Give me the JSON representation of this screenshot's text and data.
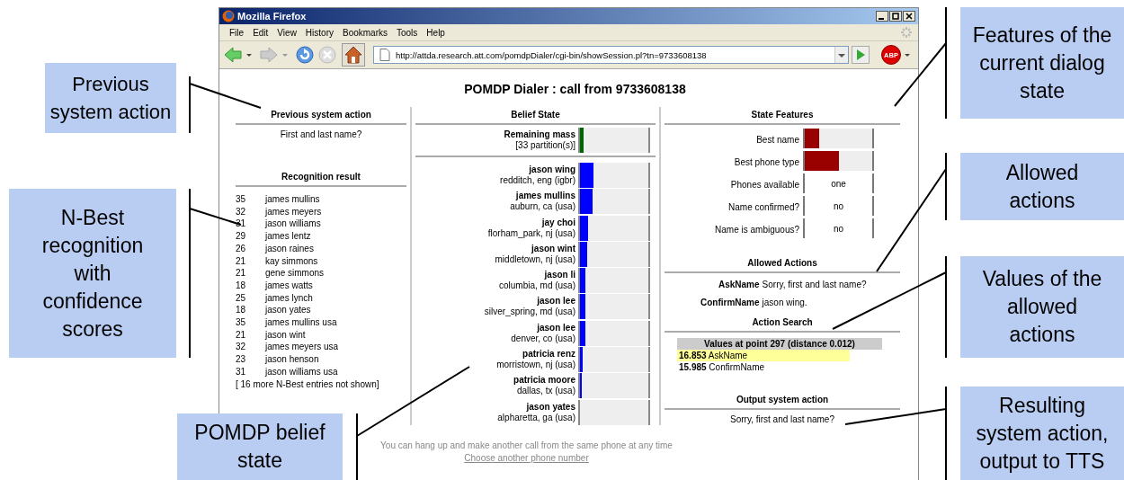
{
  "callouts": [
    {
      "text": "Previous system action"
    },
    {
      "text": "N-Best recognition with confidence scores"
    },
    {
      "text": "POMDP belief state"
    },
    {
      "text": "Features of the current dialog state"
    },
    {
      "text": "Allowed actions"
    },
    {
      "text": "Values of the allowed actions"
    },
    {
      "text": "Resulting system action, output to TTS"
    }
  ],
  "window": {
    "title": "Mozilla Firefox",
    "menu": [
      "File",
      "Edit",
      "View",
      "History",
      "Bookmarks",
      "Tools",
      "Help"
    ],
    "url": "http://attda.research.att.com/pomdpDialer/cgi-bin/showSession.pl?tn=9733608138",
    "adblock_label": "ABP"
  },
  "page": {
    "title": "POMDP Dialer : call from 9733608138",
    "previous_action": {
      "heading": "Previous system action",
      "text": "First and last name?"
    },
    "recognition": {
      "heading": "Recognition result",
      "rows": [
        {
          "score": "35",
          "name": "james mullins"
        },
        {
          "score": "32",
          "name": "james meyers"
        },
        {
          "score": "31",
          "name": "jason williams"
        },
        {
          "score": "29",
          "name": "james lentz"
        },
        {
          "score": "26",
          "name": "jason raines"
        },
        {
          "score": "21",
          "name": "kay simmons"
        },
        {
          "score": "21",
          "name": "gene simmons"
        },
        {
          "score": "18",
          "name": "james watts"
        },
        {
          "score": "25",
          "name": "james lynch"
        },
        {
          "score": "18",
          "name": "jason yates"
        },
        {
          "score": "35",
          "name": "james mullins usa"
        },
        {
          "score": "21",
          "name": "jason wint"
        },
        {
          "score": "32",
          "name": "james meyers usa"
        },
        {
          "score": "23",
          "name": "jason henson"
        },
        {
          "score": "31",
          "name": "jason williams usa"
        }
      ],
      "more": "[ 16 more N-Best entries not shown]"
    },
    "belief": {
      "heading": "Belief State",
      "remaining": {
        "name": "Remaining mass",
        "detail": "[33 partition(s)]",
        "level": 0.05
      },
      "rows": [
        {
          "name": "jason wing",
          "detail": "redditch, eng (igbr)",
          "level": 0.2
        },
        {
          "name": "james mullins",
          "detail": "auburn, ca (usa)",
          "level": 0.18
        },
        {
          "name": "jay choi",
          "detail": "florham_park, nj (usa)",
          "level": 0.12
        },
        {
          "name": "jason wint",
          "detail": "middletown, nj (usa)",
          "level": 0.1
        },
        {
          "name": "jason li",
          "detail": "columbia, md (usa)",
          "level": 0.08
        },
        {
          "name": "jason lee",
          "detail": "silver_spring, md (usa)",
          "level": 0.08
        },
        {
          "name": "jason lee",
          "detail": "denver, co (usa)",
          "level": 0.08
        },
        {
          "name": "patricia renz",
          "detail": "morristown, nj (usa)",
          "level": 0.04
        },
        {
          "name": "patricia moore",
          "detail": "dallas, tx (usa)",
          "level": 0.02
        },
        {
          "name": "jason yates",
          "detail": "alpharetta, ga (usa)",
          "level": 0
        }
      ]
    },
    "features": {
      "heading": "State Features",
      "rows": [
        {
          "kind": "bar",
          "label": "Best name",
          "level": 0.21
        },
        {
          "kind": "bar",
          "label": "Best phone type",
          "level": 0.5
        },
        {
          "kind": "value",
          "label": "Phones available",
          "value": "one"
        },
        {
          "kind": "value",
          "label": "Name confirmed?",
          "value": "no"
        },
        {
          "kind": "value",
          "label": "Name is ambiguous?",
          "value": "no"
        }
      ]
    },
    "allowed": {
      "heading": "Allowed Actions",
      "rows": [
        {
          "action": "AskName",
          "text": "Sorry, first and last name?"
        },
        {
          "action": "ConfirmName",
          "text": "jason wing."
        }
      ]
    },
    "search": {
      "heading": "Action Search",
      "values_heading": "Values at point 297 (distance 0.012)",
      "rows": [
        {
          "value": "16.853",
          "action": "AskName",
          "selected": true
        },
        {
          "value": "15.985",
          "action": "ConfirmName",
          "selected": false
        }
      ]
    },
    "output": {
      "heading": "Output system action",
      "text": "Sorry, first and last name?"
    },
    "footer": {
      "note": "You can hang up and make another call from the same phone at any time",
      "link": "Choose another phone number"
    }
  }
}
